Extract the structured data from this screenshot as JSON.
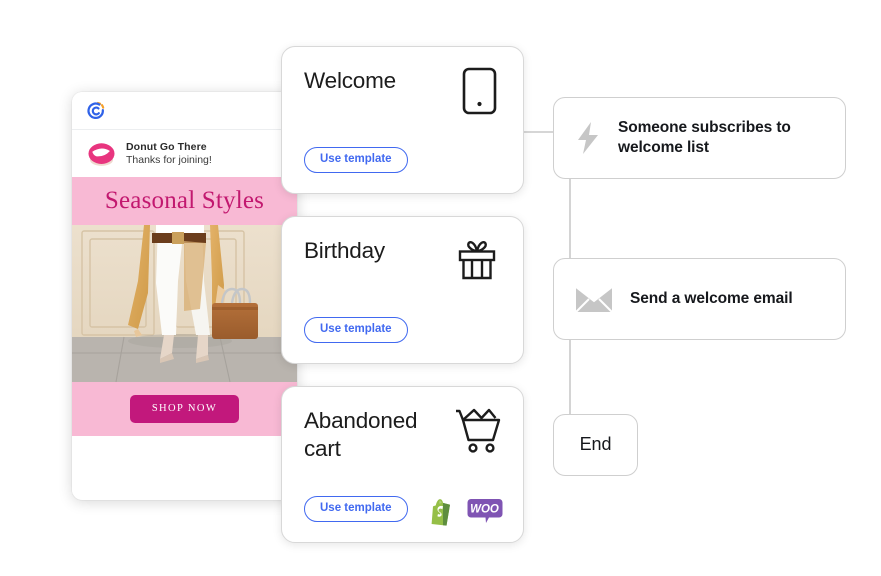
{
  "email_preview": {
    "brand_icon": "constant-contact-logo",
    "sender_logo_icon": "donut-logo",
    "sender_name": "Donut Go There",
    "sender_subject": "Thanks for joining!",
    "banner_title": "Seasonal Styles",
    "photo_alt": "fashion-model-photo",
    "cta_label": "SHOP NOW",
    "colors": {
      "banner_bg": "#f8b9d4",
      "banner_text": "#c2186f",
      "cta_bg": "#c2187c"
    }
  },
  "templates": [
    {
      "title": "Welcome",
      "icon": "mobile-phone-icon",
      "button_label": "Use template",
      "badges": []
    },
    {
      "title": "Birthday",
      "icon": "gift-box-icon",
      "button_label": "Use template",
      "badges": []
    },
    {
      "title": "Abandoned cart",
      "icon": "shopping-cart-icon",
      "button_label": "Use template",
      "badges": [
        {
          "name": "shopify-badge",
          "label": "S",
          "color": "#95bf47"
        },
        {
          "name": "woocommerce-badge",
          "label": "WOO",
          "color": "#7f54b3"
        }
      ]
    }
  ],
  "flow": {
    "nodes": [
      {
        "label": "Someone subscribes to welcome list",
        "icon": "lightning-bolt-icon"
      },
      {
        "label": "Send a welcome email",
        "icon": "envelope-icon"
      },
      {
        "label": "End",
        "icon": "none"
      }
    ],
    "connector_color": "#c9c9c9"
  },
  "accent_color": "#4169f0"
}
